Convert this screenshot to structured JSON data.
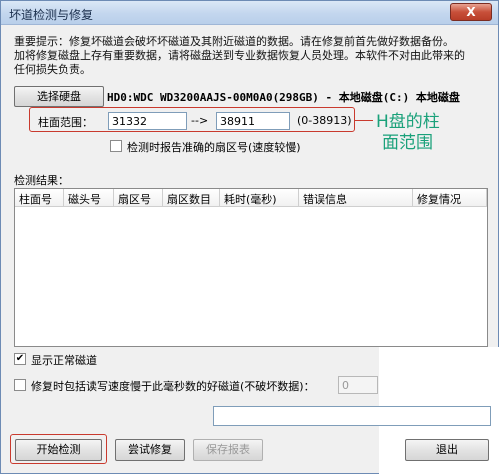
{
  "window": {
    "title": "坏道检测与修复",
    "close_label": "X"
  },
  "notice": {
    "line1": "重要提示：修复坏磁道会破坏坏磁道及其附近磁道的数据。请在修复前首先做好数据备份。",
    "line2": "加将修复磁盘上存有重要数据，请将磁盘送到专业数据恢复人员处理。本软件不对由此带来的",
    "line3": "任何损失负责。"
  },
  "disk": {
    "select_button": "选择硬盘",
    "info": "HD0:WDC WD3200AAJS-00M0A0(298GB) - 本地磁盘(C:) 本地磁盘"
  },
  "range": {
    "label": "柱面范围：",
    "start": "31332",
    "arrow": "-->",
    "end": "38911",
    "hint": "(0-38913)"
  },
  "options": {
    "report_sector": "检测时报告准确的扇区号(速度较慢)",
    "show_normal": "显示正常磁道",
    "show_normal_checked": true,
    "repair_slow": "修复时包括读写速度慢于此毫秒数的好磁道(不破坏数据)：",
    "repair_slow_value": "0"
  },
  "annotation": {
    "line1": "H盘的柱",
    "line2": "面范围"
  },
  "results": {
    "label": "检测结果：",
    "columns": [
      "柱面号",
      "磁头号",
      "扇区号",
      "扇区数目",
      "耗时(毫秒)",
      "错误信息",
      "修复情况"
    ]
  },
  "buttons": {
    "start": "开始检测",
    "try_repair": "尝试修复",
    "save_report": "保存报表",
    "exit": "退出"
  },
  "colors": {
    "annotation_border": "#c93a2e",
    "annotation_text": "#1aa17a"
  }
}
